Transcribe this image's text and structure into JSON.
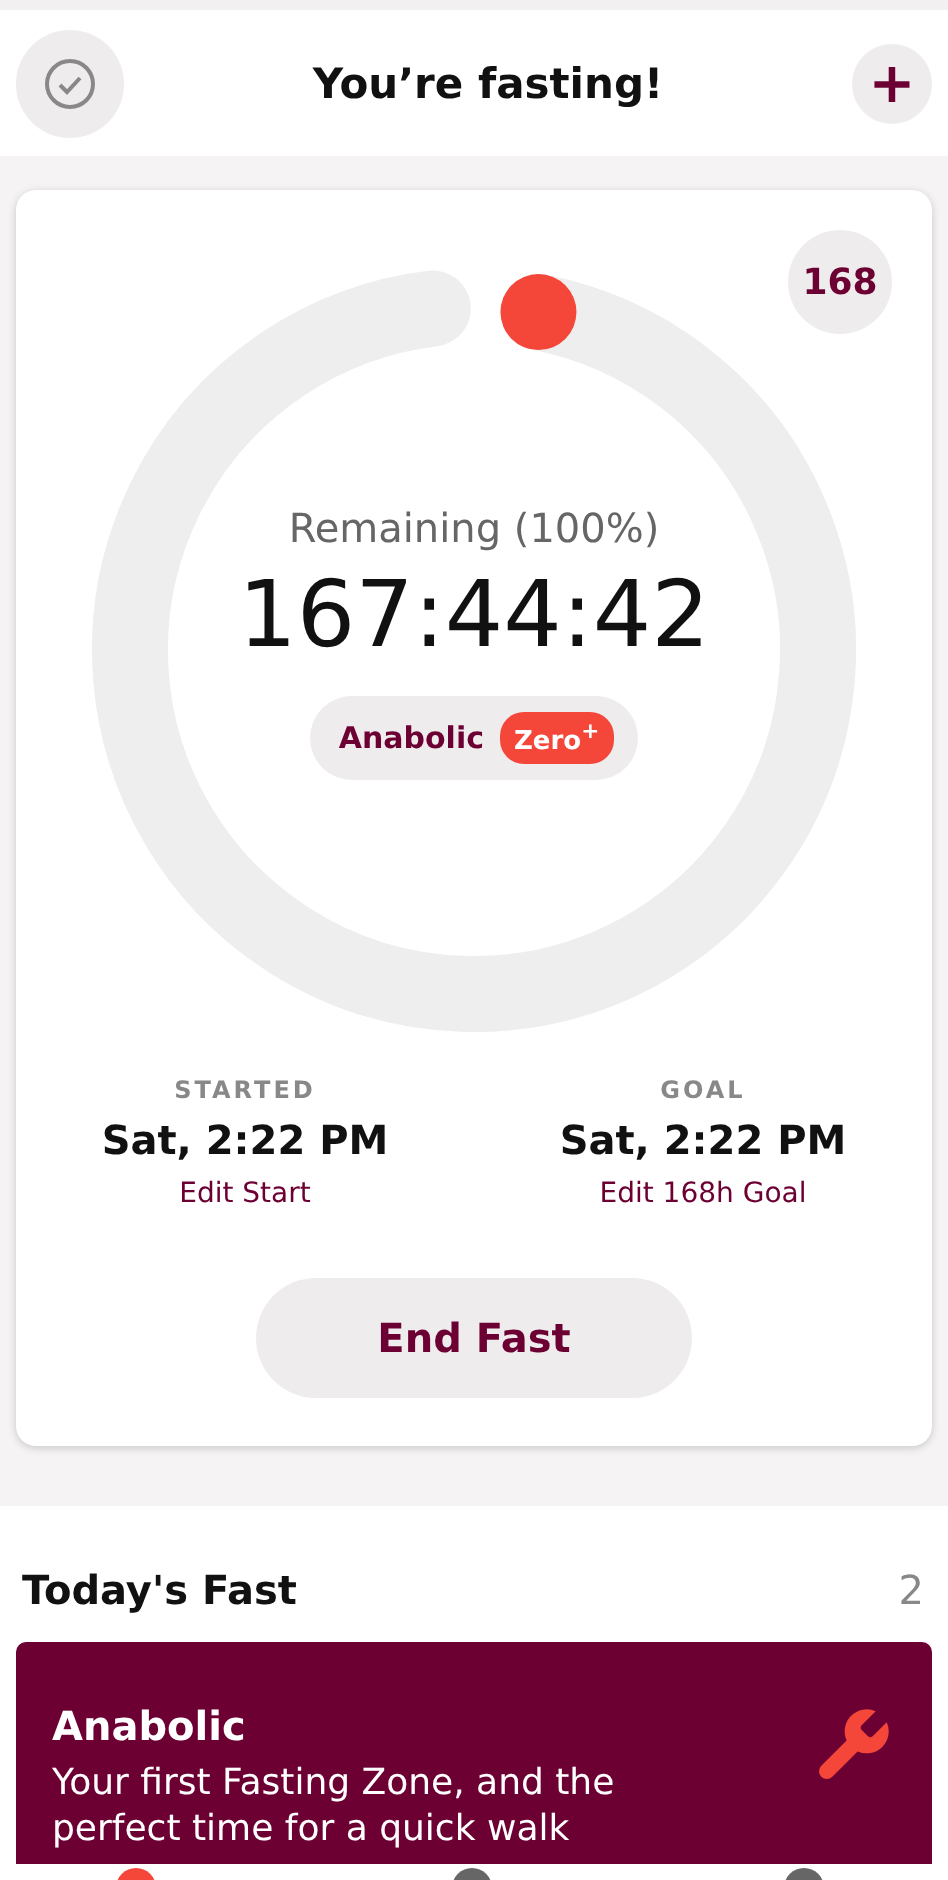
{
  "header": {
    "title": "You’re fasting!",
    "add_button": "+"
  },
  "timer": {
    "goal_badge": "168",
    "caption": "Remaining (100%)",
    "time": "167:44:42",
    "zone": {
      "name": "Anabolic",
      "tag": "Zero$^{+}$"
    }
  },
  "schedule": [
    {
      "label": "STARTED",
      "time": "Sat, 2:22 PM",
      "link": "Edit Start"
    },
    {
      "label": "GOAL",
      "time": "Sat, 2:22 PM",
      "link": "Edit 168h Goal"
    }
  ],
  "end_button": "End Fast",
  "today": {
    "title": "Today's Fast",
    "count": "2",
    "zone_card": {
      "title": "Anabolic",
      "text": "Your first Fasting Zone, and the perfect time for a quick walk"
    }
  }
}
